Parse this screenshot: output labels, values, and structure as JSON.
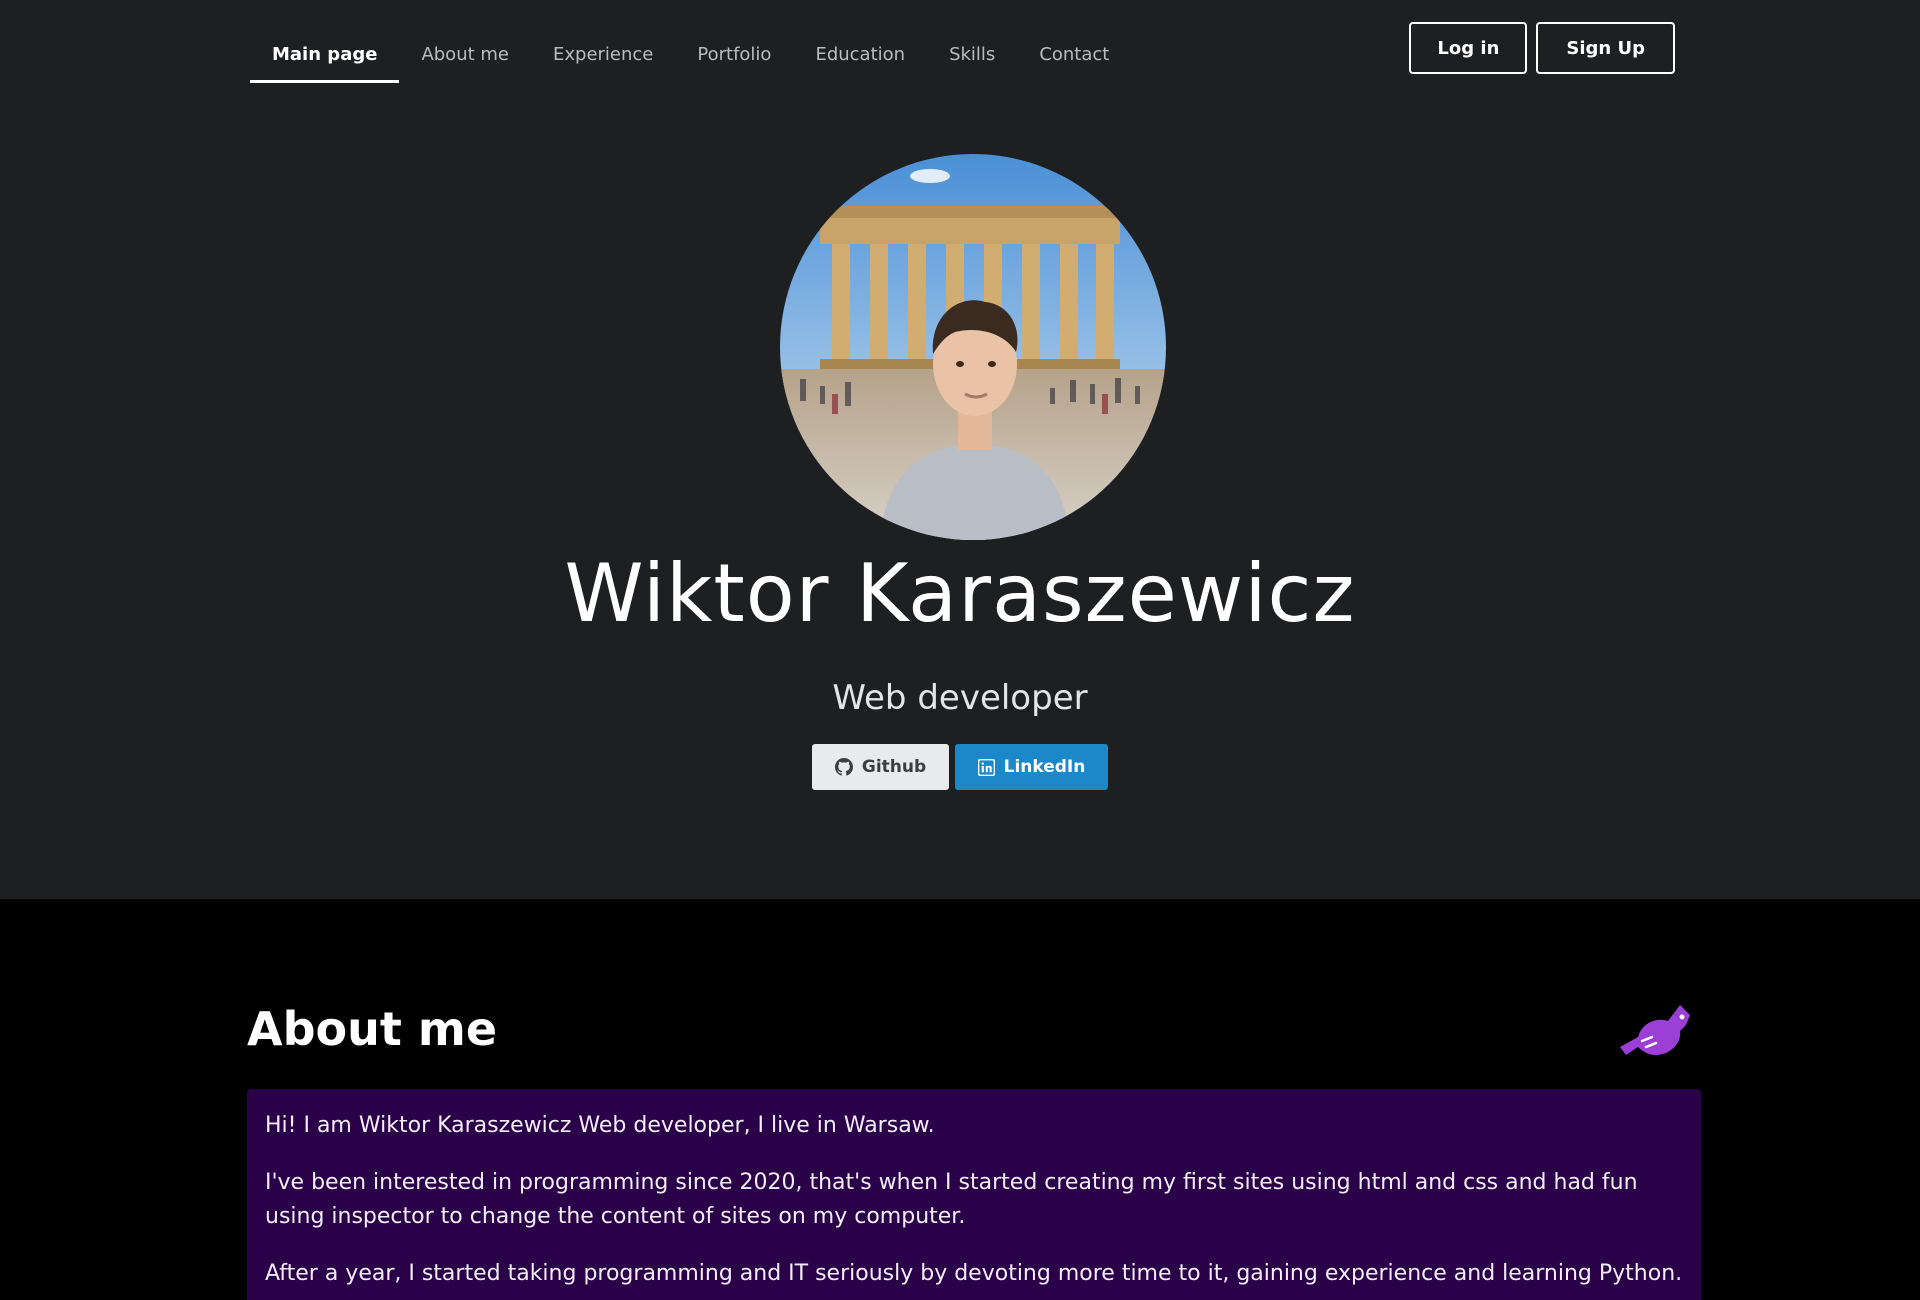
{
  "nav": {
    "items": [
      {
        "label": "Main page",
        "active": true
      },
      {
        "label": "About me",
        "active": false
      },
      {
        "label": "Experience",
        "active": false
      },
      {
        "label": "Portfolio",
        "active": false
      },
      {
        "label": "Education",
        "active": false
      },
      {
        "label": "Skills",
        "active": false
      },
      {
        "label": "Contact",
        "active": false
      }
    ],
    "login_label": "Log in",
    "signup_label": "Sign Up"
  },
  "hero": {
    "avatar_icon": "profile-photo",
    "name": "Wiktor Karaszewicz",
    "role": "Web developer",
    "github_label": "Github",
    "linkedin_label": "LinkedIn"
  },
  "about": {
    "title": "About me",
    "icon": "hand-pointing-icon",
    "paragraphs": [
      "Hi! I am Wiktor Karaszewicz Web developer, I live in Warsaw.",
      "I've been interested in programming since 2020, that's when I started creating my first sites using html and css and had fun using inspector to change the content of sites on my computer.",
      "After a year, I started taking programming and IT seriously by devoting more time to it, gaining experience and learning Python."
    ]
  },
  "colors": {
    "background": "#1e1f21",
    "about_background": "#000000",
    "about_box": "#2a0048",
    "linkedin": "#1b89c9",
    "github": "#e9eaec",
    "accent_icon": "#9b3fd6"
  }
}
